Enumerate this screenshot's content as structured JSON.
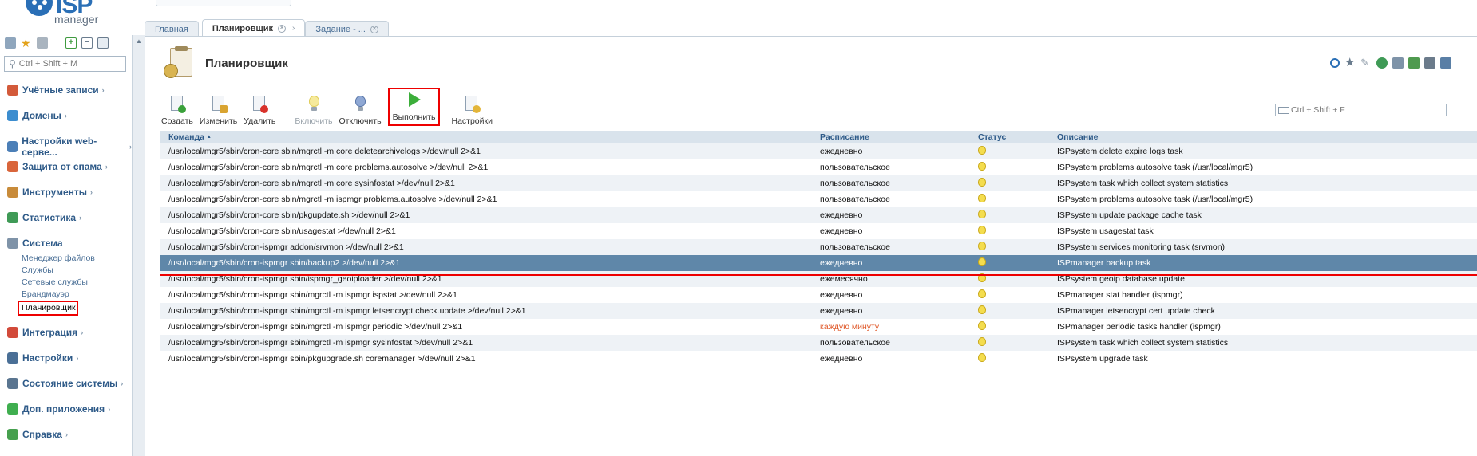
{
  "sidebar": {
    "logo_text": "ISP",
    "logo_subtext": "manager",
    "search_placeholder": "Ctrl + Shift + M",
    "groups": [
      {
        "label": "Учётные записи",
        "icon": "users-icon",
        "color": "#d35a3a"
      },
      {
        "label": "Домены",
        "icon": "globe-icon",
        "color": "#3c8dcf"
      },
      {
        "label": "Настройки web-серве...",
        "icon": "web-settings-icon",
        "color": "#4c7fb7"
      },
      {
        "label": "Защита от спама",
        "icon": "spam-shield-icon",
        "color": "#d9653b"
      },
      {
        "label": "Инструменты",
        "icon": "tools-icon",
        "color": "#c88b3a"
      },
      {
        "label": "Статистика",
        "icon": "statistics-icon",
        "color": "#3f9a56"
      },
      {
        "label": "Система",
        "icon": "system-icon",
        "color": "#7f93a8"
      },
      {
        "label": "Интеграция",
        "icon": "integration-icon",
        "color": "#d24a3a"
      },
      {
        "label": "Настройки",
        "icon": "settings-icon",
        "color": "#4a6f96"
      },
      {
        "label": "Состояние системы",
        "icon": "system-status-icon",
        "color": "#5a7590"
      },
      {
        "label": "Доп. приложения",
        "icon": "apps-icon",
        "color": "#3fae4f"
      },
      {
        "label": "Справка",
        "icon": "help-icon",
        "color": "#46a04e"
      }
    ],
    "system_items": [
      "Менеджер файлов",
      "Службы",
      "Сетевые службы",
      "Брандмауэр",
      "Планировщик"
    ]
  },
  "tabs": [
    {
      "label": "Главная"
    },
    {
      "label": "Планировщик"
    },
    {
      "label": "Задание - ..."
    }
  ],
  "page": {
    "title": "Планировщик",
    "filter_placeholder": "Ctrl + Shift + F"
  },
  "toolbar": {
    "create": "Создать",
    "edit": "Изменить",
    "delete": "Удалить",
    "enable": "Включить",
    "disable": "Отключить",
    "run": "Выполнить",
    "settings": "Настройки"
  },
  "table": {
    "headers": {
      "command": "Команда",
      "sort_mark": "▲",
      "schedule": "Расписание",
      "status": "Статус",
      "description": "Описание"
    },
    "rows": [
      {
        "command": "/usr/local/mgr5/sbin/cron-core sbin/mgrctl -m core deletearchivelogs >/dev/null 2>&1",
        "schedule": "ежедневно",
        "description": "ISPsystem delete expire logs task"
      },
      {
        "command": "/usr/local/mgr5/sbin/cron-core sbin/mgrctl -m core problems.autosolve >/dev/null 2>&1",
        "schedule": "пользовательское",
        "description": "ISPsystem problems autosolve task (/usr/local/mgr5)"
      },
      {
        "command": "/usr/local/mgr5/sbin/cron-core sbin/mgrctl -m core sysinfostat >/dev/null 2>&1",
        "schedule": "пользовательское",
        "description": "ISPsystem task which collect system statistics"
      },
      {
        "command": "/usr/local/mgr5/sbin/cron-core sbin/mgrctl -m ispmgr problems.autosolve >/dev/null 2>&1",
        "schedule": "пользовательское",
        "description": "ISPsystem problems autosolve task (/usr/local/mgr5)"
      },
      {
        "command": "/usr/local/mgr5/sbin/cron-core sbin/pkgupdate.sh >/dev/null 2>&1",
        "schedule": "ежедневно",
        "description": "ISPsystem update package cache task"
      },
      {
        "command": "/usr/local/mgr5/sbin/cron-core sbin/usagestat >/dev/null 2>&1",
        "schedule": "ежедневно",
        "description": "ISPsystem usagestat task"
      },
      {
        "command": "/usr/local/mgr5/sbin/cron-ispmgr addon/srvmon >/dev/null 2>&1",
        "schedule": "пользовательское",
        "description": "ISPsystem services monitoring task (srvmon)"
      },
      {
        "command": "/usr/local/mgr5/sbin/cron-ispmgr sbin/backup2 >/dev/null 2>&1",
        "schedule": "ежедневно",
        "description": "ISPmanager backup task"
      },
      {
        "command": "/usr/local/mgr5/sbin/cron-ispmgr sbin/ispmgr_geoiploader >/dev/null 2>&1",
        "schedule": "ежемесячно",
        "description": "ISPsystem geoip database update"
      },
      {
        "command": "/usr/local/mgr5/sbin/cron-ispmgr sbin/mgrctl -m ispmgr ispstat >/dev/null 2>&1",
        "schedule": "ежедневно",
        "description": "ISPmanager stat handler (ispmgr)"
      },
      {
        "command": "/usr/local/mgr5/sbin/cron-ispmgr sbin/mgrctl -m ispmgr letsencrypt.check.update >/dev/null 2>&1",
        "schedule": "ежедневно",
        "description": "ISPmanager letsencrypt cert update check"
      },
      {
        "command": "/usr/local/mgr5/sbin/cron-ispmgr sbin/mgrctl -m ispmgr periodic >/dev/null 2>&1",
        "schedule": "каждую минуту",
        "description": "ISPmanager periodic tasks handler (ispmgr)"
      },
      {
        "command": "/usr/local/mgr5/sbin/cron-ispmgr sbin/mgrctl -m ispmgr sysinfostat >/dev/null 2>&1",
        "schedule": "пользовательское",
        "description": "ISPsystem task which collect system statistics"
      },
      {
        "command": "/usr/local/mgr5/sbin/cron-ispmgr sbin/pkgupgrade.sh coremanager >/dev/null 2>&1",
        "schedule": "ежедневно",
        "description": "ISPsystem upgrade task"
      }
    ]
  },
  "colors": {
    "selected_row": "#5f87a9",
    "highlight_border": "#e00000",
    "warning_text": "#e05a2b",
    "status_bulb": "#f4dd4e"
  },
  "icons": {
    "status": "lightbulb-icon",
    "header": [
      "refresh-icon",
      "star-icon",
      "pin-icon",
      "globe-icon",
      "window-icon",
      "export-icon",
      "print-icon",
      "columns-icon"
    ]
  }
}
